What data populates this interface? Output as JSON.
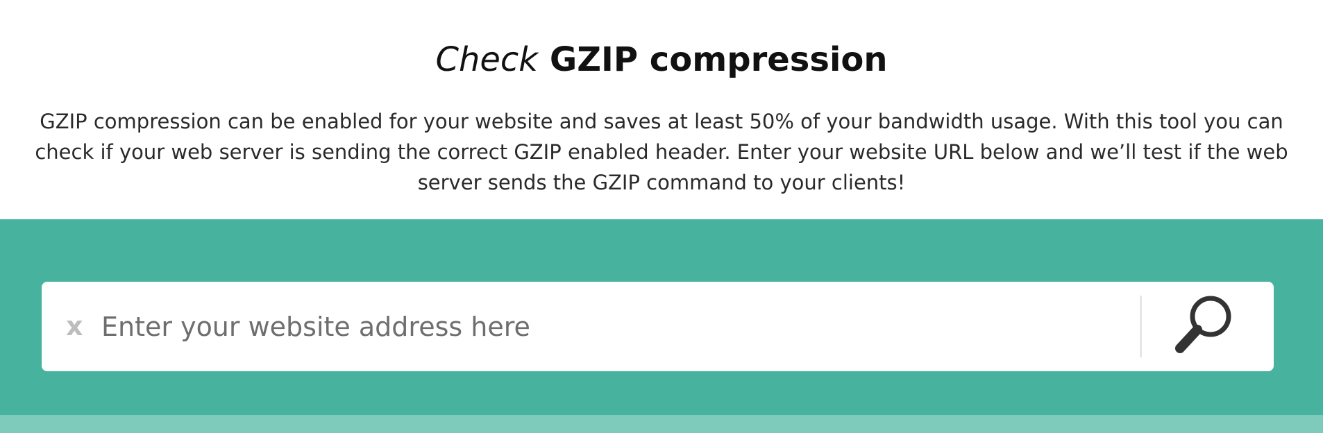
{
  "header": {
    "title_light": "Check",
    "title_bold": "GZIP compression",
    "intro": "GZIP compression can be enabled for your website and saves at least 50% of your bandwidth usage. With this tool you can check if your web server is sending the correct GZIP enabled header. Enter your website URL below and we’ll test if the web server sends the GZIP command to your clients!"
  },
  "search": {
    "clear_label": "x",
    "placeholder": "Enter your website address here",
    "value": "",
    "button_icon": "search-icon"
  },
  "colors": {
    "band": "#47b39f",
    "band_bottom": "#7fcbbb",
    "icon": "#333333"
  }
}
